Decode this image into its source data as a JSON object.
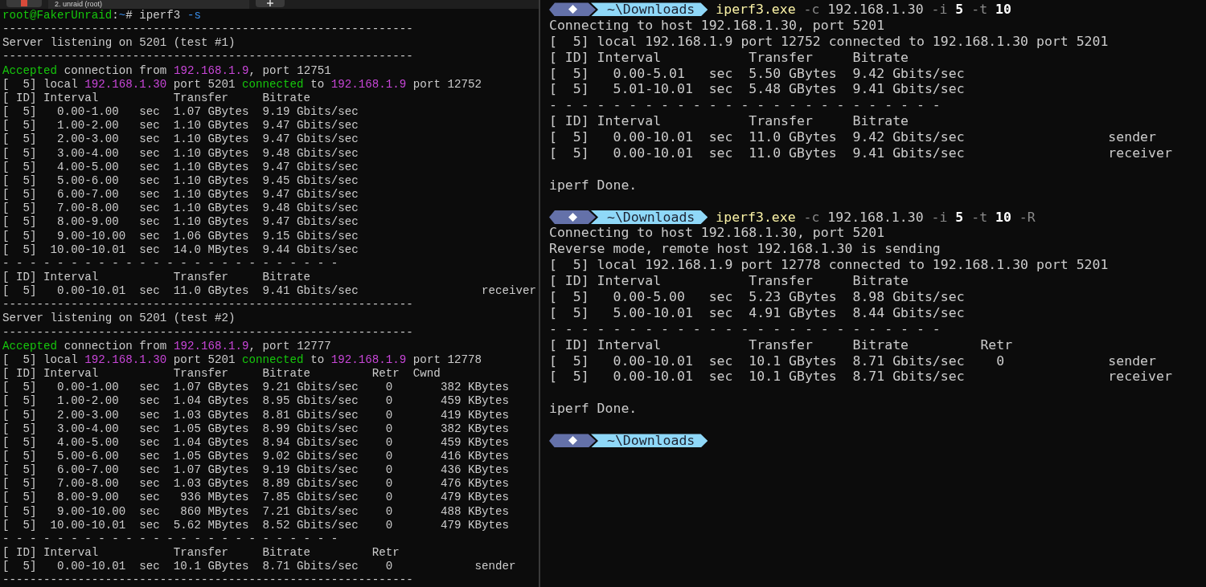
{
  "tab_bar": {
    "tab_title": "2. unraid (root)"
  },
  "left_terminal": {
    "lines": [
      {
        "spans": [
          {
            "text": "root@FakerUnraid",
            "kind": "green"
          },
          {
            "text": ":",
            "kind": "plain"
          },
          {
            "text": "~",
            "kind": "blue"
          },
          {
            "text": "# iperf3 ",
            "kind": "plain"
          },
          {
            "text": "-s",
            "kind": "blue"
          }
        ]
      },
      {
        "spans": [
          {
            "text": "------------------------------------------------------------",
            "kind": "plain"
          }
        ]
      },
      {
        "spans": [
          {
            "text": "Server listening on 5201 (test #1)",
            "kind": "plain"
          }
        ]
      },
      {
        "spans": [
          {
            "text": "------------------------------------------------------------",
            "kind": "plain"
          }
        ]
      },
      {
        "spans": [
          {
            "text": "Accepted",
            "kind": "green"
          },
          {
            "text": " connection from ",
            "kind": "plain"
          },
          {
            "text": "192.168.1.9",
            "kind": "magenta"
          },
          {
            "text": ", port 12751",
            "kind": "plain"
          }
        ]
      },
      {
        "spans": [
          {
            "text": "[  5] local ",
            "kind": "plain"
          },
          {
            "text": "192.168.1.30",
            "kind": "magenta"
          },
          {
            "text": " port 5201 ",
            "kind": "plain"
          },
          {
            "text": "connected",
            "kind": "green"
          },
          {
            "text": " to ",
            "kind": "plain"
          },
          {
            "text": "192.168.1.9",
            "kind": "magenta"
          },
          {
            "text": " port 12752",
            "kind": "plain"
          }
        ]
      },
      {
        "spans": [
          {
            "text": "[ ID] Interval           Transfer     Bitrate",
            "kind": "plain"
          }
        ]
      },
      {
        "spans": [
          {
            "text": "[  5]   0.00-1.00   sec  1.07 GBytes  9.19 Gbits/sec",
            "kind": "plain"
          }
        ]
      },
      {
        "spans": [
          {
            "text": "[  5]   1.00-2.00   sec  1.10 GBytes  9.47 Gbits/sec",
            "kind": "plain"
          }
        ]
      },
      {
        "spans": [
          {
            "text": "[  5]   2.00-3.00   sec  1.10 GBytes  9.47 Gbits/sec",
            "kind": "plain"
          }
        ]
      },
      {
        "spans": [
          {
            "text": "[  5]   3.00-4.00   sec  1.10 GBytes  9.48 Gbits/sec",
            "kind": "plain"
          }
        ]
      },
      {
        "spans": [
          {
            "text": "[  5]   4.00-5.00   sec  1.10 GBytes  9.47 Gbits/sec",
            "kind": "plain"
          }
        ]
      },
      {
        "spans": [
          {
            "text": "[  5]   5.00-6.00   sec  1.10 GBytes  9.45 Gbits/sec",
            "kind": "plain"
          }
        ]
      },
      {
        "spans": [
          {
            "text": "[  5]   6.00-7.00   sec  1.10 GBytes  9.47 Gbits/sec",
            "kind": "plain"
          }
        ]
      },
      {
        "spans": [
          {
            "text": "[  5]   7.00-8.00   sec  1.10 GBytes  9.48 Gbits/sec",
            "kind": "plain"
          }
        ]
      },
      {
        "spans": [
          {
            "text": "[  5]   8.00-9.00   sec  1.10 GBytes  9.47 Gbits/sec",
            "kind": "plain"
          }
        ]
      },
      {
        "spans": [
          {
            "text": "[  5]   9.00-10.00  sec  1.06 GBytes  9.15 Gbits/sec",
            "kind": "plain"
          }
        ]
      },
      {
        "spans": [
          {
            "text": "[  5]  10.00-10.01  sec  14.0 MBytes  9.44 Gbits/sec",
            "kind": "plain"
          }
        ]
      },
      {
        "spans": [
          {
            "text": "- - - - - - - - - - - - - - - - - - - - - - - - -",
            "kind": "plain"
          }
        ]
      },
      {
        "spans": [
          {
            "text": "[ ID] Interval           Transfer     Bitrate",
            "kind": "plain"
          }
        ]
      },
      {
        "spans": [
          {
            "text": "[  5]   0.00-10.01  sec  11.0 GBytes  9.41 Gbits/sec                  receiver",
            "kind": "plain"
          }
        ]
      },
      {
        "spans": [
          {
            "text": "------------------------------------------------------------",
            "kind": "plain"
          }
        ]
      },
      {
        "spans": [
          {
            "text": "Server listening on 5201 (test #2)",
            "kind": "plain"
          }
        ]
      },
      {
        "spans": [
          {
            "text": "------------------------------------------------------------",
            "kind": "plain"
          }
        ]
      },
      {
        "spans": [
          {
            "text": "Accepted",
            "kind": "green"
          },
          {
            "text": " connection from ",
            "kind": "plain"
          },
          {
            "text": "192.168.1.9",
            "kind": "magenta"
          },
          {
            "text": ", port 12777",
            "kind": "plain"
          }
        ]
      },
      {
        "spans": [
          {
            "text": "[  5] local ",
            "kind": "plain"
          },
          {
            "text": "192.168.1.30",
            "kind": "magenta"
          },
          {
            "text": " port 5201 ",
            "kind": "plain"
          },
          {
            "text": "connected",
            "kind": "green"
          },
          {
            "text": " to ",
            "kind": "plain"
          },
          {
            "text": "192.168.1.9",
            "kind": "magenta"
          },
          {
            "text": " port 12778",
            "kind": "plain"
          }
        ]
      },
      {
        "spans": [
          {
            "text": "[ ID] Interval           Transfer     Bitrate         Retr  Cwnd",
            "kind": "plain"
          }
        ]
      },
      {
        "spans": [
          {
            "text": "[  5]   0.00-1.00   sec  1.07 GBytes  9.21 Gbits/sec    0       382 KBytes",
            "kind": "plain"
          }
        ]
      },
      {
        "spans": [
          {
            "text": "[  5]   1.00-2.00   sec  1.04 GBytes  8.95 Gbits/sec    0       459 KBytes",
            "kind": "plain"
          }
        ]
      },
      {
        "spans": [
          {
            "text": "[  5]   2.00-3.00   sec  1.03 GBytes  8.81 Gbits/sec    0       419 KBytes",
            "kind": "plain"
          }
        ]
      },
      {
        "spans": [
          {
            "text": "[  5]   3.00-4.00   sec  1.05 GBytes  8.99 Gbits/sec    0       382 KBytes",
            "kind": "plain"
          }
        ]
      },
      {
        "spans": [
          {
            "text": "[  5]   4.00-5.00   sec  1.04 GBytes  8.94 Gbits/sec    0       459 KBytes",
            "kind": "plain"
          }
        ]
      },
      {
        "spans": [
          {
            "text": "[  5]   5.00-6.00   sec  1.05 GBytes  9.02 Gbits/sec    0       416 KBytes",
            "kind": "plain"
          }
        ]
      },
      {
        "spans": [
          {
            "text": "[  5]   6.00-7.00   sec  1.07 GBytes  9.19 Gbits/sec    0       436 KBytes",
            "kind": "plain"
          }
        ]
      },
      {
        "spans": [
          {
            "text": "[  5]   7.00-8.00   sec  1.03 GBytes  8.89 Gbits/sec    0       476 KBytes",
            "kind": "plain"
          }
        ]
      },
      {
        "spans": [
          {
            "text": "[  5]   8.00-9.00   sec   936 MBytes  7.85 Gbits/sec    0       479 KBytes",
            "kind": "plain"
          }
        ]
      },
      {
        "spans": [
          {
            "text": "[  5]   9.00-10.00  sec   860 MBytes  7.21 Gbits/sec    0       488 KBytes",
            "kind": "plain"
          }
        ]
      },
      {
        "spans": [
          {
            "text": "[  5]  10.00-10.01  sec  5.62 MBytes  8.52 Gbits/sec    0       479 KBytes",
            "kind": "plain"
          }
        ]
      },
      {
        "spans": [
          {
            "text": "- - - - - - - - - - - - - - - - - - - - - - - - -",
            "kind": "plain"
          }
        ]
      },
      {
        "spans": [
          {
            "text": "[ ID] Interval           Transfer     Bitrate         Retr",
            "kind": "plain"
          }
        ]
      },
      {
        "spans": [
          {
            "text": "[  5]   0.00-10.01  sec  10.1 GBytes  8.71 Gbits/sec    0            sender",
            "kind": "plain"
          }
        ]
      },
      {
        "spans": [
          {
            "text": "------------------------------------------------------------",
            "kind": "plain"
          }
        ]
      }
    ]
  },
  "right_terminal": {
    "lines": [
      {
        "kind": "prompt",
        "path": "~\\Downloads",
        "spans": [
          {
            "text": "iperf3.exe",
            "kind": "yellow"
          },
          {
            "text": " -c",
            "kind": "dim"
          },
          {
            "text": " 192.168.1.30",
            "kind": "plain"
          },
          {
            "text": " -i",
            "kind": "dim"
          },
          {
            "text": " 5",
            "kind": "bold"
          },
          {
            "text": " -t",
            "kind": "dim"
          },
          {
            "text": " 10",
            "kind": "bold"
          }
        ]
      },
      {
        "kind": "output",
        "text": "Connecting to host 192.168.1.30, port 5201"
      },
      {
        "kind": "output",
        "text": "[  5] local 192.168.1.9 port 12752 connected to 192.168.1.30 port 5201"
      },
      {
        "kind": "output",
        "text": "[ ID] Interval           Transfer     Bitrate"
      },
      {
        "kind": "output",
        "text": "[  5]   0.00-5.01   sec  5.50 GBytes  9.42 Gbits/sec"
      },
      {
        "kind": "output",
        "text": "[  5]   5.01-10.01  sec  5.48 GBytes  9.41 Gbits/sec"
      },
      {
        "kind": "output",
        "text": "- - - - - - - - - - - - - - - - - - - - - - - - -"
      },
      {
        "kind": "output",
        "text": "[ ID] Interval           Transfer     Bitrate"
      },
      {
        "kind": "output",
        "text": "[  5]   0.00-10.01  sec  11.0 GBytes  9.42 Gbits/sec                  sender"
      },
      {
        "kind": "output",
        "text": "[  5]   0.00-10.01  sec  11.0 GBytes  9.41 Gbits/sec                  receiver"
      },
      {
        "kind": "blank"
      },
      {
        "kind": "output",
        "text": "iperf Done."
      },
      {
        "kind": "blank"
      },
      {
        "kind": "prompt",
        "path": "~\\Downloads",
        "spans": [
          {
            "text": "iperf3.exe",
            "kind": "yellow"
          },
          {
            "text": " -c",
            "kind": "dim"
          },
          {
            "text": " 192.168.1.30",
            "kind": "plain"
          },
          {
            "text": " -i",
            "kind": "dim"
          },
          {
            "text": " 5",
            "kind": "bold"
          },
          {
            "text": " -t",
            "kind": "dim"
          },
          {
            "text": " 10",
            "kind": "bold"
          },
          {
            "text": " -R",
            "kind": "dim"
          }
        ]
      },
      {
        "kind": "output",
        "text": "Connecting to host 192.168.1.30, port 5201"
      },
      {
        "kind": "output",
        "text": "Reverse mode, remote host 192.168.1.30 is sending"
      },
      {
        "kind": "output",
        "text": "[  5] local 192.168.1.9 port 12778 connected to 192.168.1.30 port 5201"
      },
      {
        "kind": "output",
        "text": "[ ID] Interval           Transfer     Bitrate"
      },
      {
        "kind": "output",
        "text": "[  5]   0.00-5.00   sec  5.23 GBytes  8.98 Gbits/sec"
      },
      {
        "kind": "output",
        "text": "[  5]   5.00-10.01  sec  4.91 GBytes  8.44 Gbits/sec"
      },
      {
        "kind": "output",
        "text": "- - - - - - - - - - - - - - - - - - - - - - - - -"
      },
      {
        "kind": "output",
        "text": "[ ID] Interval           Transfer     Bitrate         Retr"
      },
      {
        "kind": "output",
        "text": "[  5]   0.00-10.01  sec  10.1 GBytes  8.71 Gbits/sec    0             sender"
      },
      {
        "kind": "output",
        "text": "[  5]   0.00-10.01  sec  10.1 GBytes  8.71 Gbits/sec                  receiver"
      },
      {
        "kind": "blank"
      },
      {
        "kind": "output",
        "text": "iperf Done."
      },
      {
        "kind": "blank"
      },
      {
        "kind": "prompt",
        "path": "~\\Downloads"
      }
    ]
  }
}
